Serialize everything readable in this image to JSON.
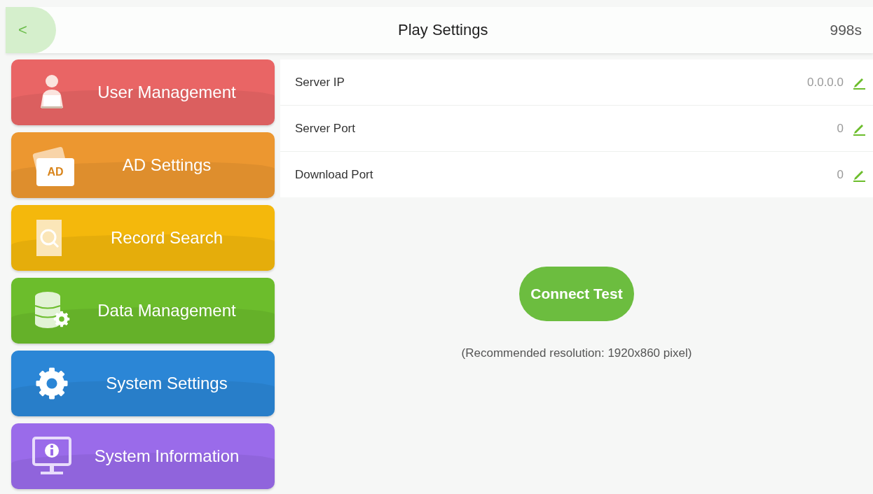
{
  "header": {
    "back": "<",
    "title": "Play Settings",
    "countdown": "998s"
  },
  "menu": [
    {
      "label": "User Management",
      "kind": "user",
      "color": "#e96565"
    },
    {
      "label": "AD Settings",
      "kind": "ad",
      "icon_text": "AD",
      "color": "#ec9730"
    },
    {
      "label": "Record Search",
      "kind": "search",
      "color": "#f4b80c"
    },
    {
      "label": "Data Management",
      "kind": "data",
      "color": "#6cbd2c"
    },
    {
      "label": "System Settings",
      "kind": "gear",
      "color": "#2b86d6"
    },
    {
      "label": "System Information",
      "kind": "info",
      "color": "#9a6bea"
    }
  ],
  "settings": [
    {
      "label": "Server IP",
      "value": "0.0.0.0"
    },
    {
      "label": "Server Port",
      "value": "0"
    },
    {
      "label": "Download Port",
      "value": "0"
    }
  ],
  "connect_button": "Connect Test",
  "note": "(Recommended resolution: 1920x860 pixel)"
}
